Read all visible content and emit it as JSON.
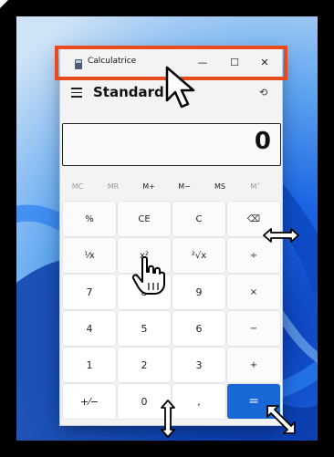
{
  "window": {
    "title": "Calculatrice",
    "controls": {
      "minimize": "—",
      "maximize": "☐",
      "close": "✕"
    }
  },
  "header": {
    "mode": "Standard",
    "history_icon": "history-icon"
  },
  "display": {
    "value": "0"
  },
  "memory": {
    "mc": "MC",
    "mr": "MR",
    "mplus": "M+",
    "mminus": "M−",
    "ms": "MS",
    "mlist": "M˅"
  },
  "keys": {
    "percent": "%",
    "ce": "CE",
    "c": "C",
    "backspace": "⌫",
    "reciprocal": "¹⁄x",
    "square": "x²",
    "sqrt": "²√x",
    "divide": "÷",
    "seven": "7",
    "eight": "8",
    "nine": "9",
    "multiply": "×",
    "four": "4",
    "five": "5",
    "six": "6",
    "minus": "−",
    "one": "1",
    "two": "2",
    "three": "3",
    "plus": "+",
    "negate": "+⁄−",
    "zero": "0",
    "comma": ",",
    "equals": "="
  },
  "colors": {
    "accent": "#1768d4",
    "highlight": "#e74b1e"
  }
}
